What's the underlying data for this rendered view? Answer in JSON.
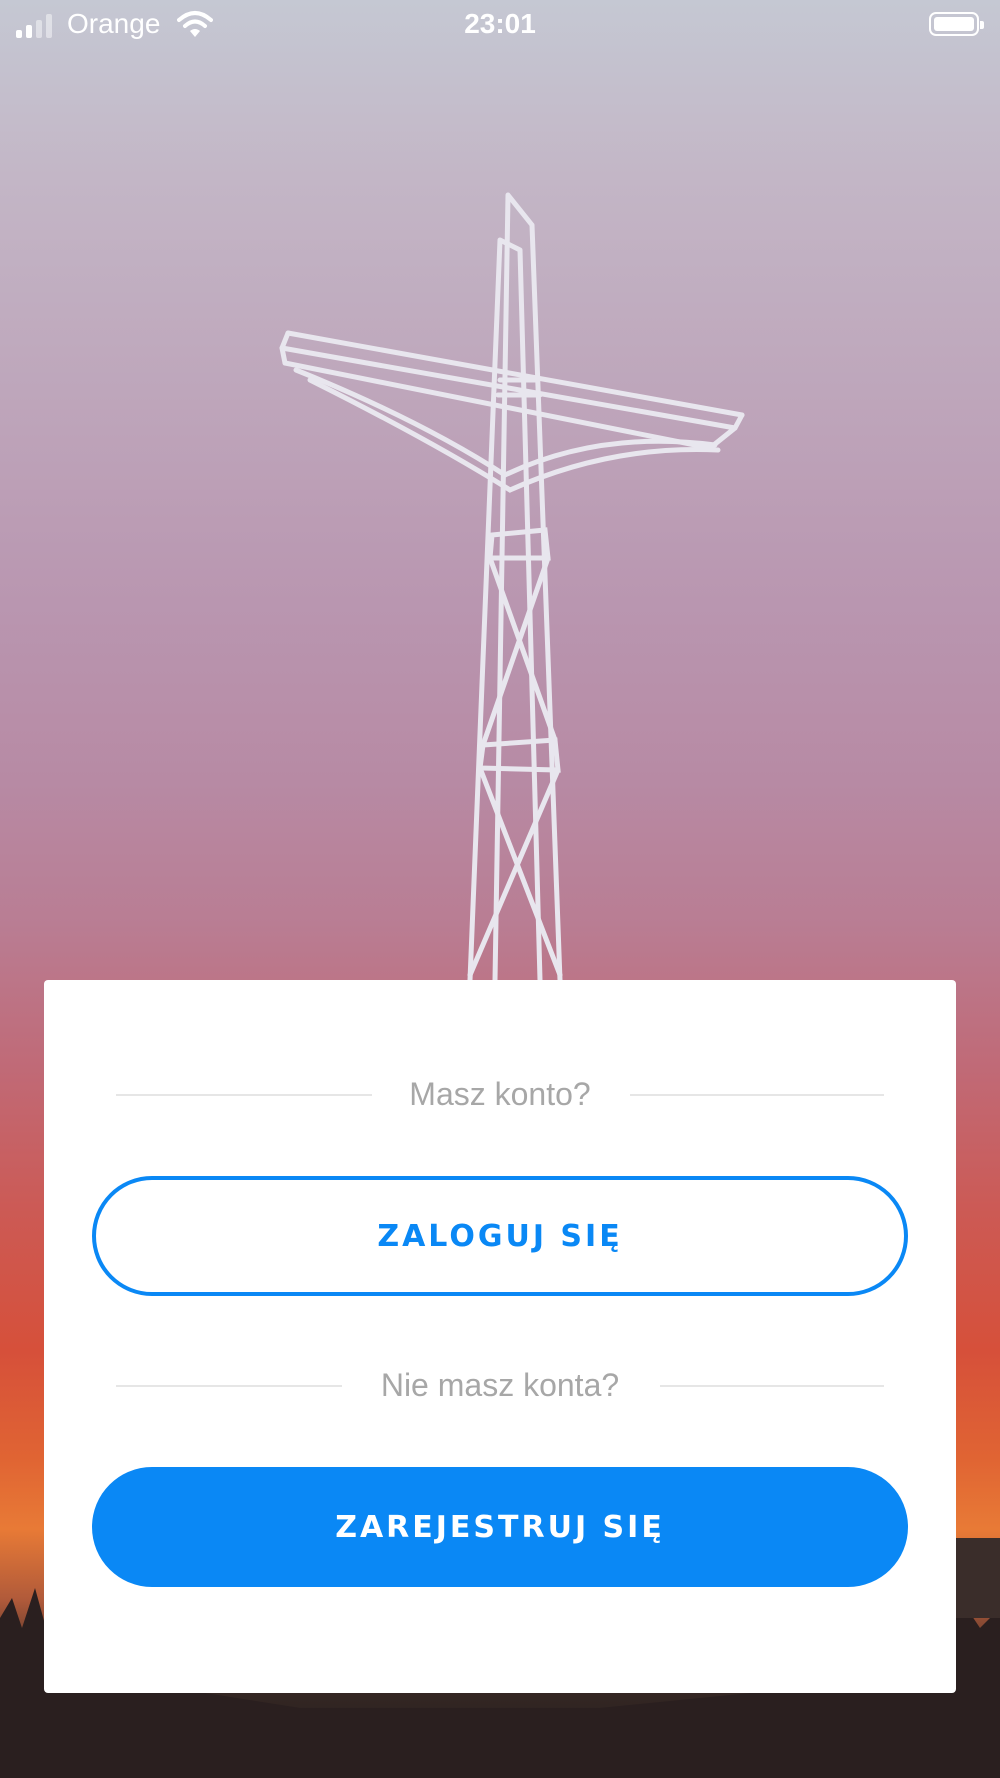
{
  "status_bar": {
    "carrier": "Orange",
    "time": "23:01",
    "signal_bars_active": 2,
    "signal_bars_total": 4,
    "battery_level": 1.0
  },
  "icons": {
    "wifi": "wifi-icon",
    "battery": "battery-icon",
    "signal": "signal-icon"
  },
  "auth": {
    "have_account_text": "Masz konto?",
    "login_label": "ZALOGUJ SIĘ",
    "no_account_text": "Nie masz konta?",
    "register_label": "ZAREJESTRUJ SIĘ"
  },
  "colors": {
    "accent": "#0a88f5",
    "prompt_text": "#a7a7a7"
  }
}
